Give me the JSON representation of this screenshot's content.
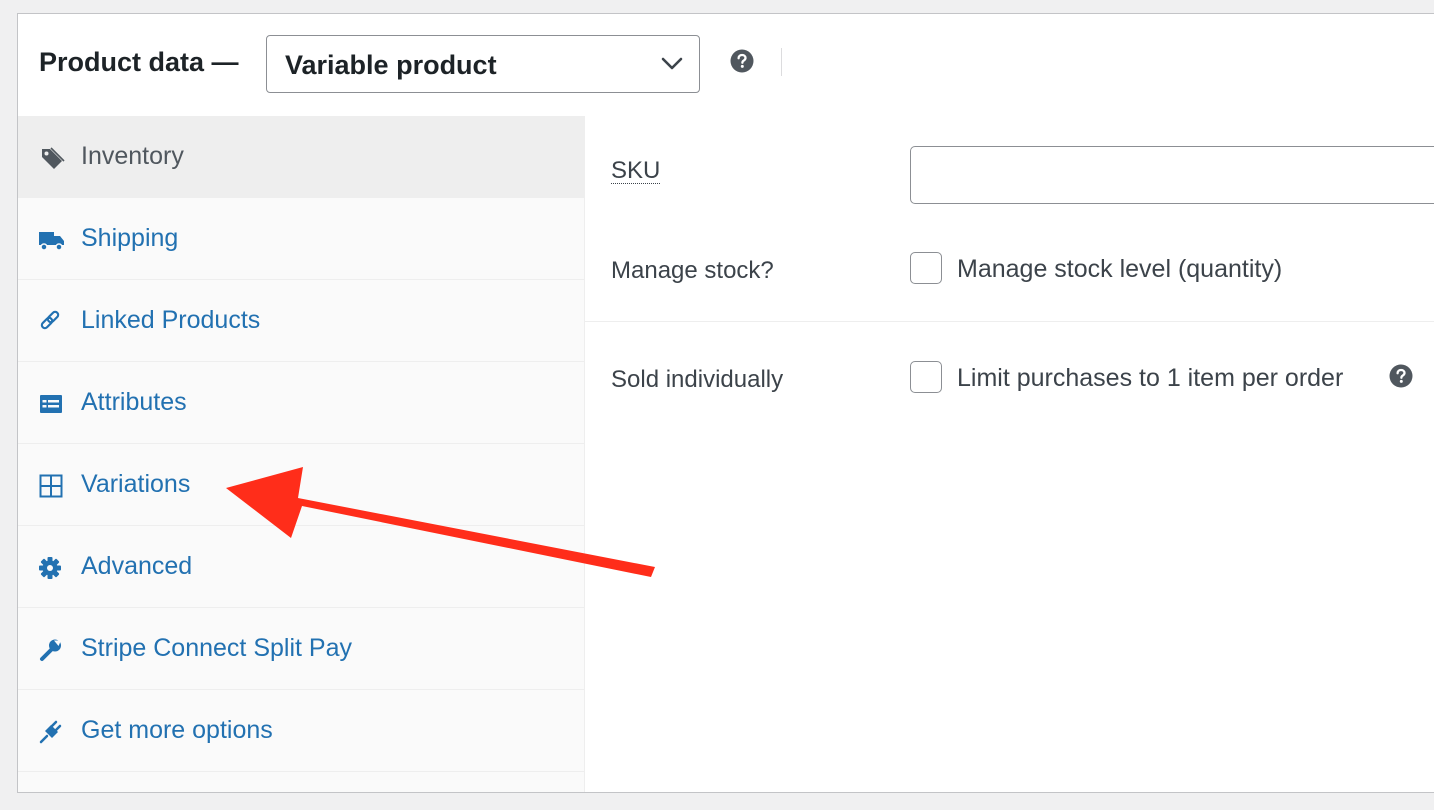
{
  "header": {
    "title": "Product data —",
    "product_type": "Variable product",
    "help_icon": "help-icon"
  },
  "sidebar": {
    "items": [
      {
        "label": "Inventory",
        "icon": "tag-icon",
        "active": true
      },
      {
        "label": "Shipping",
        "icon": "truck-icon"
      },
      {
        "label": "Linked Products",
        "icon": "link-icon"
      },
      {
        "label": "Attributes",
        "icon": "list-icon"
      },
      {
        "label": "Variations",
        "icon": "grid-icon"
      },
      {
        "label": "Advanced",
        "icon": "gear-icon"
      },
      {
        "label": "Stripe Connect Split Pay",
        "icon": "wrench-icon"
      },
      {
        "label": "Get more options",
        "icon": "plug-icon"
      }
    ]
  },
  "inventory": {
    "sku_label": "SKU",
    "sku_value": "",
    "manage_stock_label": "Manage stock?",
    "manage_stock_checkbox_label": "Manage stock level (quantity)",
    "manage_stock_checked": false,
    "sold_individually_label": "Sold individually",
    "sold_individually_checkbox_label": "Limit purchases to 1 item per order",
    "sold_individually_checked": false
  },
  "annotation": {
    "arrow_color": "#ff2d1a",
    "target": "Variations"
  },
  "colors": {
    "link": "#2271b1",
    "active_tab_bg": "#eeeeee",
    "sidebar_bg": "#fafafa"
  }
}
